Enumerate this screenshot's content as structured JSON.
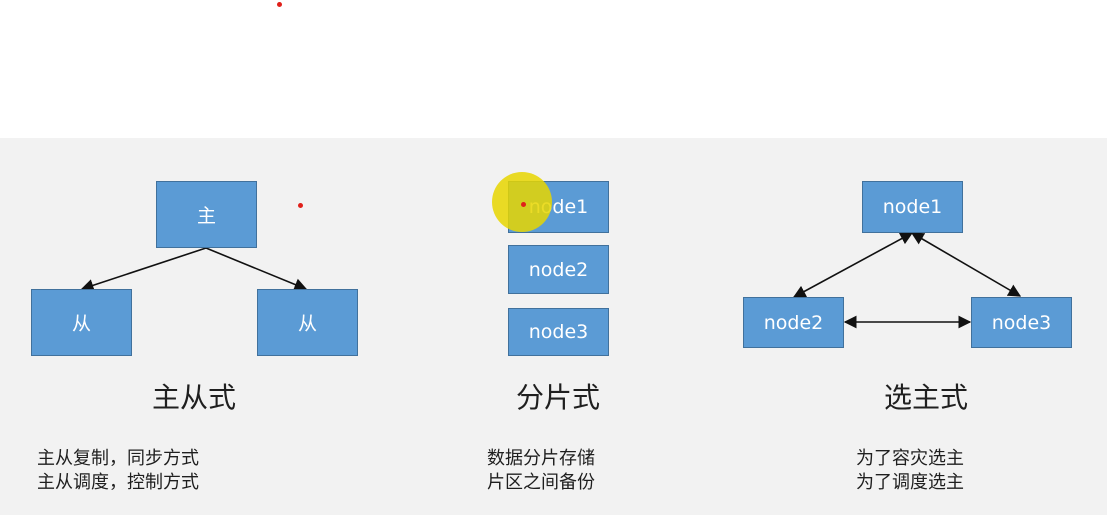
{
  "master_slave": {
    "master_label": "主",
    "slave_left_label": "从",
    "slave_right_label": "从",
    "title": "主从式",
    "desc_line1": "主从复制，同步方式",
    "desc_line2": "主从调度，控制方式"
  },
  "sharding": {
    "node1_label": "node1",
    "node2_label": "node2",
    "node3_label": "node3",
    "title": "分片式",
    "desc_line1": "数据分片存储",
    "desc_line2": "片区之间备份"
  },
  "election": {
    "node1_label": "node1",
    "node2_label": "node2",
    "node3_label": "node3",
    "title": "选主式",
    "desc_line1": "为了容灾选主",
    "desc_line2": "为了调度选主"
  },
  "colors": {
    "node_fill": "#5b9bd5",
    "node_border": "#41719c",
    "pointer_dot": "#e0201a",
    "cursor_highlight": "#e8d600"
  }
}
